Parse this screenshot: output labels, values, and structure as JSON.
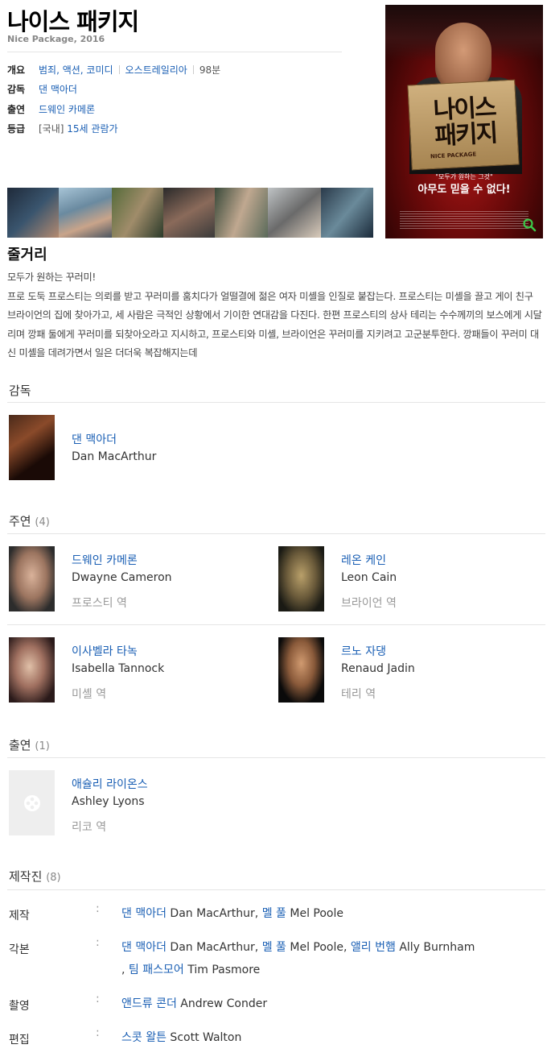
{
  "movie": {
    "title": "나이스 패키지",
    "subtitle": "Nice Package, 2016"
  },
  "info": {
    "overview_label": "개요",
    "genres": "범죄, 액션, 코미디",
    "country": "오스트레일리아",
    "runtime": "98분",
    "director_label": "감독",
    "director": "댄 맥아더",
    "cast_label": "출연",
    "cast": "드웨인 카메론",
    "rating_label": "등급",
    "rating_prefix": "[국내]",
    "rating": "15세 관람가"
  },
  "poster": {
    "title_line1": "나이스",
    "title_line2": "패키지",
    "title_en": "NICE PACKAGE",
    "tagline1": "\"모두가 원하는 그것\"",
    "tagline2": "아무도 믿을 수 없다!",
    "zoom_icon": "search-icon"
  },
  "synopsis": {
    "heading": "줄거리",
    "line1": "모두가 원하는 꾸러미!",
    "body": " 프로 도둑 프로스티는 의뢰를 받고 꾸러미를 훔치다가 얼떨결에 젊은 여자 미셸을 인질로 붙잡는다. 프로스티는 미셸을 끌고 게이 친구 브라이언의 집에 찾아가고, 세 사람은 극적인 상황에서 기이한 연대감을 다진다. 한편 프로스티의 상사 테리는 수수께끼의 보스에게 시달리며 깡패 둘에게 꾸러미를 되찾아오라고 지시하고, 프로스티와 미셸, 브라이언은 꾸러미를 지키려고 고군분투한다. 깡패들이 꾸러미 대신 미셸을 데려가면서 일은 더더욱 복잡해지는데"
  },
  "director_section": {
    "heading": "감독",
    "person": {
      "name_kr": "댄 맥아더",
      "name_en": "Dan MacArthur"
    }
  },
  "lead_section": {
    "heading": "주연",
    "count": "(4)",
    "people": [
      {
        "name_kr": "드웨인 카메론",
        "name_en": "Dwayne Cameron",
        "role": "프로스티 역"
      },
      {
        "name_kr": "레온 케인",
        "name_en": "Leon Cain",
        "role": "브라이언 역"
      },
      {
        "name_kr": "이사벨라 타녹",
        "name_en": "Isabella Tannock",
        "role": "미셸 역"
      },
      {
        "name_kr": "르노 자댕",
        "name_en": "Renaud Jadin",
        "role": "테리 역"
      }
    ]
  },
  "support_section": {
    "heading": "출연",
    "count": "(1)",
    "people": [
      {
        "name_kr": "애슐리 라이온스",
        "name_en": "Ashley Lyons",
        "role": "리코 역"
      }
    ]
  },
  "crew_section": {
    "heading": "제작진",
    "count": "(8)",
    "rows": [
      {
        "key": "제작",
        "colon": ":",
        "items": [
          {
            "kr": "댄 맥아더",
            "en": " Dan MacArthur, "
          },
          {
            "kr": "멜 풀",
            "en": " Mel Poole"
          }
        ]
      },
      {
        "key": "각본",
        "colon": ":",
        "items": [
          {
            "kr": "댄 맥아더",
            "en": " Dan MacArthur, "
          },
          {
            "kr": "멜 풀",
            "en": " Mel Poole, "
          },
          {
            "kr": "앨리 번햄",
            "en": " Ally Burnham"
          },
          {
            "kr": "팀 패스모어",
            "en": " Tim Pasmore",
            "prefix": ", "
          }
        ]
      },
      {
        "key": "촬영",
        "colon": ":",
        "items": [
          {
            "kr": "앤드류 콘더",
            "en": " Andrew Conder"
          }
        ]
      },
      {
        "key": "편집",
        "colon": ":",
        "items": [
          {
            "kr": "스콧 왈튼",
            "en": " Scott Walton"
          }
        ]
      }
    ]
  }
}
